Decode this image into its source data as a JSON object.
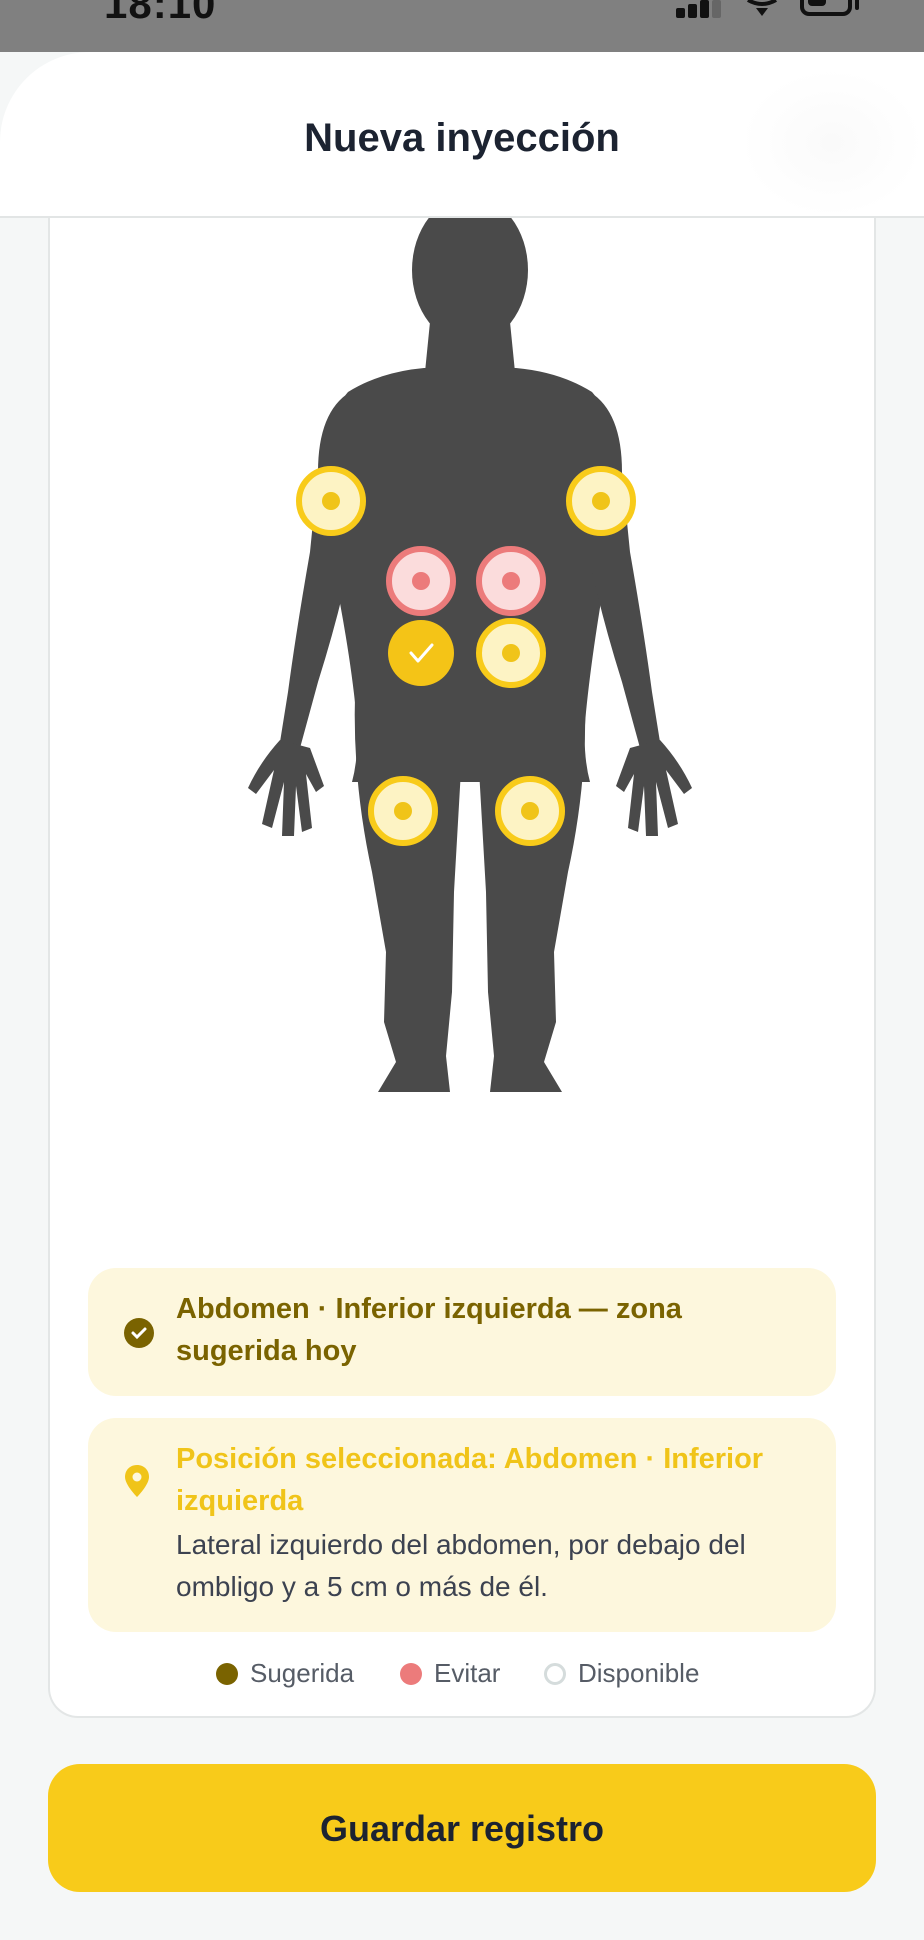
{
  "status_bar": {
    "time": "18:10"
  },
  "header": {
    "title": "Nueva inyección"
  },
  "body_map": {
    "sites": [
      {
        "name": "site-upper-arm-right",
        "state": "available"
      },
      {
        "name": "site-upper-arm-left",
        "state": "available"
      },
      {
        "name": "site-abdomen-upper-right",
        "state": "avoid"
      },
      {
        "name": "site-abdomen-upper-left",
        "state": "avoid"
      },
      {
        "name": "site-abdomen-lower-right",
        "state": "selected"
      },
      {
        "name": "site-abdomen-lower-left",
        "state": "available"
      },
      {
        "name": "site-thigh-right",
        "state": "available"
      },
      {
        "name": "site-thigh-left",
        "state": "available"
      }
    ]
  },
  "suggestion": {
    "text": "Abdomen · Inferior izquierda — zona sugerida hoy"
  },
  "selection": {
    "title": "Posición seleccionada: Abdomen · Inferior izquierda",
    "description": "Lateral izquierdo del abdomen, por debajo del ombligo y a 5 cm o más de él."
  },
  "legend": {
    "suggested": "Sugerida",
    "avoid": "Evitar",
    "available": "Disponible"
  },
  "colors": {
    "accent": "#f8cb1a",
    "suggested": "#7a6300",
    "avoid": "#ec7b7b",
    "available_border": "#d5dcdc",
    "figure": "#4a4a4a"
  },
  "actions": {
    "save_label": "Guardar registro"
  }
}
